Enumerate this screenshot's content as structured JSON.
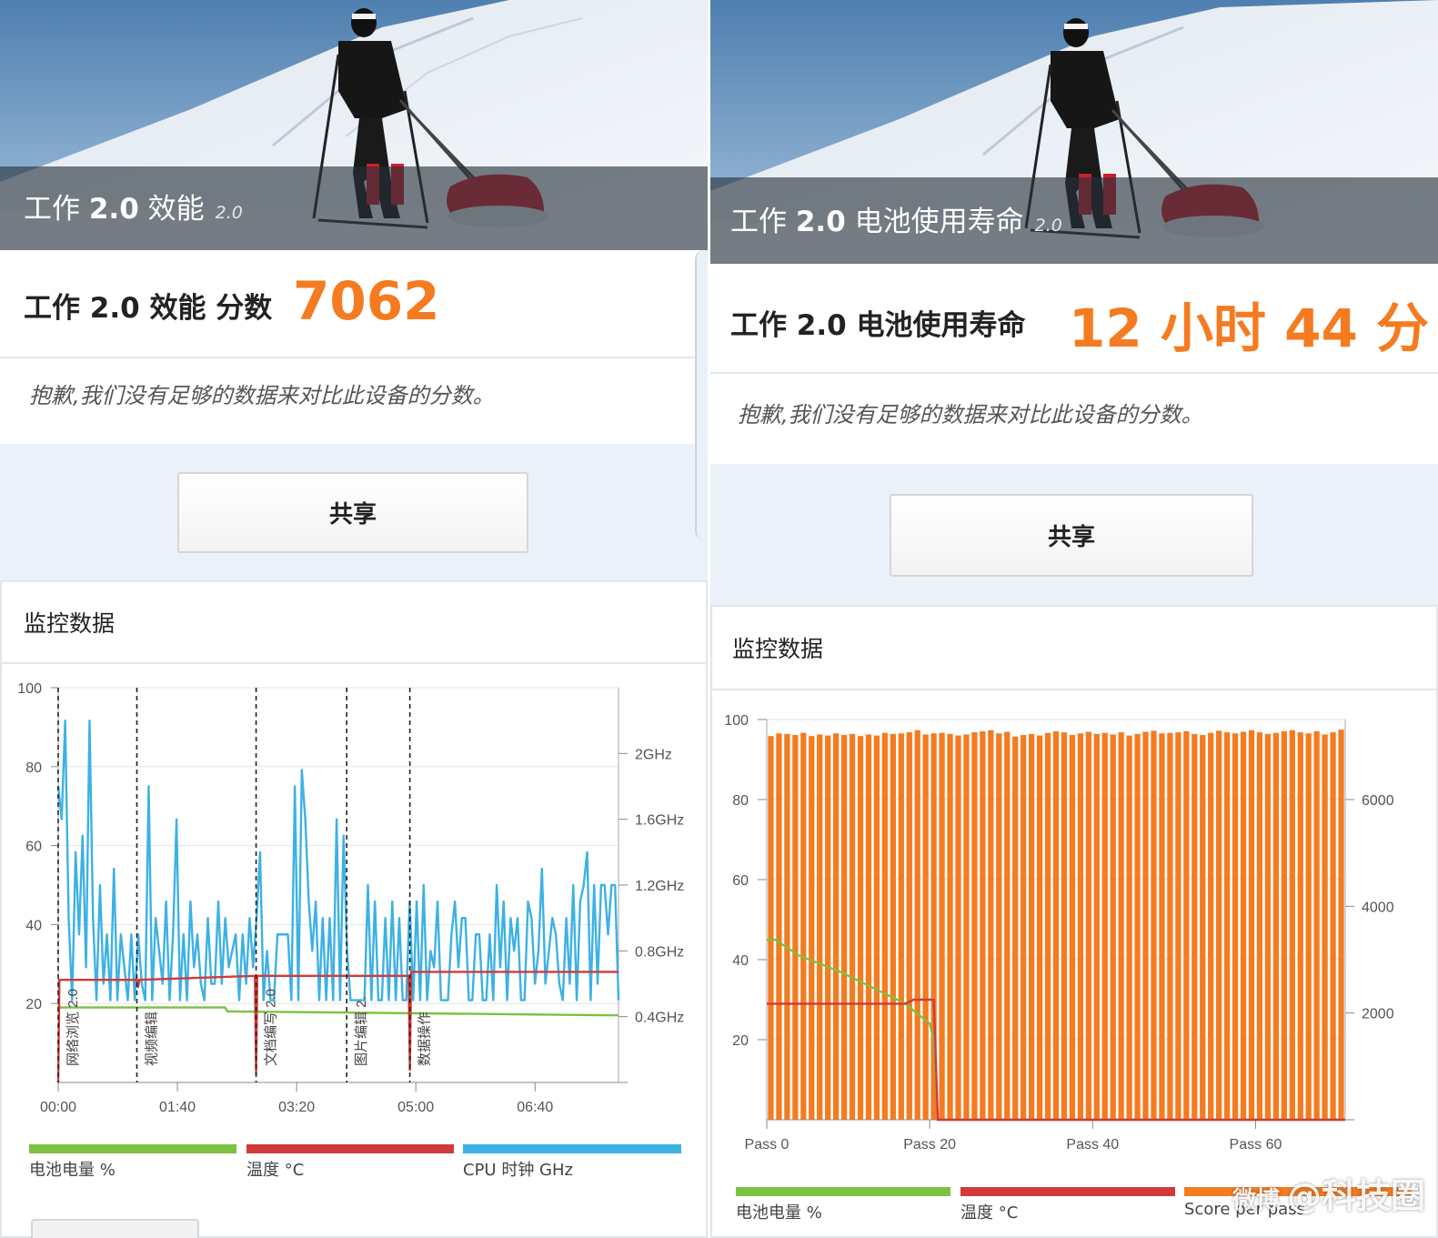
{
  "left": {
    "hero": {
      "title_part1": "工作 ",
      "title_bold": "2.0",
      "title_part2": " 效能",
      "version": "2.0"
    },
    "score": {
      "label": "工作 2.0 效能 分数",
      "value": "7062"
    },
    "sorry": "抱歉,我们没有足够的数据来对比此设备的分数。",
    "share_label": "共享",
    "monitor_title": "监控数据",
    "legend": [
      {
        "label": "电池电量 %",
        "color": "#7cc142"
      },
      {
        "label": "温度 °C",
        "color": "#d23a3a"
      },
      {
        "label": "CPU 时钟 GHz",
        "color": "#3db1e3"
      }
    ]
  },
  "right": {
    "hero": {
      "title_part1": "工作 ",
      "title_bold": "2.0",
      "title_part2": " 电池使用寿命",
      "version": "2.0"
    },
    "score": {
      "label": "工作 2.0 电池使用寿命",
      "value": "12 小时 44 分"
    },
    "sorry": "抱歉,我们没有足够的数据来对比此设备的分数。",
    "share_label": "共享",
    "monitor_title": "监控数据",
    "legend": [
      {
        "label": "电池电量 %",
        "color": "#7cc142"
      },
      {
        "label": "温度 °C",
        "color": "#d23a3a"
      },
      {
        "label": "Score per pass",
        "color": "#f47b20"
      }
    ]
  },
  "watermark": {
    "brand": "微博",
    "text": "@科技圈"
  },
  "chart_data": [
    {
      "type": "line",
      "x_ticks": [
        "00:00",
        "01:40",
        "03:20",
        "05:00",
        "06:40"
      ],
      "y_left_ticks": [
        "100",
        "80",
        "60",
        "40",
        "20"
      ],
      "y_left_range": [
        0,
        100
      ],
      "y_right_ticks": [
        "2GHz",
        "1.6GHz",
        "1.2GHz",
        "0.8GHz",
        "0.4GHz"
      ],
      "y_right_values": [
        2.0,
        1.6,
        1.2,
        0.8,
        0.4
      ],
      "y_right_range": [
        0,
        2.4
      ],
      "x_range_seconds": [
        0,
        470
      ],
      "phases": [
        {
          "label": "网络浏览 2.0",
          "t": 0
        },
        {
          "label": "视频编辑",
          "t": 66
        },
        {
          "label": "文档编写 2.0",
          "t": 166
        },
        {
          "label": "图片编辑 2.",
          "t": 242
        },
        {
          "label": "数据操作",
          "t": 295
        }
      ],
      "series": [
        {
          "name": "电池电量 %",
          "color": "#7cc142",
          "points": [
            [
              0,
              19
            ],
            [
              140,
              19
            ],
            [
              142,
              18
            ],
            [
              470,
              17
            ]
          ]
        },
        {
          "name": "温度 °C",
          "color": "#d23a3a",
          "points": [
            [
              0,
              0
            ],
            [
              1,
              26
            ],
            [
              66,
              26
            ],
            [
              67,
              24
            ],
            [
              68,
              26
            ],
            [
              165,
              27
            ],
            [
              166,
              2
            ],
            [
              167,
              27
            ],
            [
              242,
              27
            ],
            [
              243,
              27
            ],
            [
              294,
              27
            ],
            [
              295,
              3
            ],
            [
              296,
              28
            ],
            [
              470,
              28
            ]
          ]
        },
        {
          "name": "CPU 时钟 GHz",
          "color": "#3db1e3",
          "values_ghz": [
            1.8,
            1.6,
            2.2,
            1.0,
            0.5,
            1.4,
            0.9,
            1.5,
            0.7,
            2.2,
            1.0,
            0.5,
            1.2,
            0.6,
            0.9,
            0.5,
            1.3,
            0.5,
            0.9,
            0.7,
            0.5,
            0.9,
            0.5,
            0.9,
            0.6,
            0.5,
            1.8,
            0.5,
            1.0,
            0.8,
            0.6,
            1.1,
            0.5,
            0.9,
            1.6,
            0.5,
            0.9,
            0.5,
            1.1,
            0.7,
            0.9,
            0.6,
            0.5,
            1.0,
            0.6,
            0.6,
            1.1,
            0.6,
            1.0,
            0.7,
            0.8,
            0.9,
            0.5,
            0.9,
            0.6,
            1.0,
            0.7,
            1.0,
            1.4,
            0.5,
            0.8,
            0.5,
            0.5,
            0.9,
            0.9,
            0.9,
            0.9,
            0.5,
            1.8,
            0.5,
            1.9,
            1.6,
            1.1,
            0.8,
            1.1,
            0.5,
            1.0,
            0.5,
            1.0,
            0.5,
            1.6,
            0.5,
            1.5,
            0.8,
            0.5,
            0.5,
            0.5,
            0.5,
            0.5,
            1.2,
            0.5,
            1.1,
            0.5,
            0.5,
            1.0,
            0.5,
            1.1,
            0.5,
            1.0,
            0.5,
            0.5,
            1.1,
            0.5,
            1.1,
            0.5,
            1.2,
            0.5,
            0.8,
            0.7,
            1.1,
            0.5,
            0.5,
            0.5,
            0.9,
            1.1,
            0.7,
            1.0,
            1.0,
            0.5,
            0.5,
            0.9,
            0.9,
            0.5,
            0.5,
            0.9,
            0.5,
            1.2,
            0.7,
            1.1,
            0.5,
            1.0,
            0.8,
            1.0,
            0.5,
            0.5,
            1.1,
            1.0,
            0.6,
            0.8,
            1.3,
            0.6,
            0.8,
            1.0,
            0.9,
            0.6,
            0.5,
            1.0,
            0.6,
            1.2,
            0.5,
            1.1,
            1.2,
            1.4,
            0.5,
            1.2,
            0.6,
            1.2,
            1.2,
            0.9,
            1.2,
            1.2,
            0.5
          ]
        }
      ]
    },
    {
      "type": "bar",
      "x_ticks": [
        "Pass 0",
        "Pass 20",
        "Pass 40",
        "Pass 60"
      ],
      "y_left_ticks": [
        "100",
        "80",
        "60",
        "40",
        "20"
      ],
      "y_left_range": [
        0,
        100
      ],
      "y_right_ticks": [
        "6000",
        "4000",
        "2000"
      ],
      "y_right_range": [
        0,
        7500
      ],
      "pass_count": 71,
      "series": [
        {
          "name": "Score per pass",
          "color": "#f47b20",
          "values": [
            7190,
            7240,
            7230,
            7210,
            7250,
            7190,
            7220,
            7200,
            7240,
            7210,
            7230,
            7190,
            7220,
            7200,
            7250,
            7230,
            7240,
            7260,
            7300,
            7220,
            7240,
            7250,
            7230,
            7200,
            7220,
            7260,
            7280,
            7300,
            7240,
            7270,
            7180,
            7210,
            7230,
            7200,
            7250,
            7280,
            7260,
            7210,
            7240,
            7270,
            7230,
            7250,
            7220,
            7260,
            7200,
            7230,
            7270,
            7290,
            7240,
            7250,
            7260,
            7280,
            7230,
            7210,
            7250,
            7290,
            7260,
            7240,
            7270,
            7300,
            7260,
            7230,
            7250,
            7280,
            7300,
            7260,
            7240,
            7280,
            7220,
            7260,
            7310
          ]
        },
        {
          "name": "电池电量 %",
          "color": "#7cc142",
          "points": [
            [
              0,
              45
            ],
            [
              1,
              45
            ],
            [
              4,
              41
            ],
            [
              9,
              37
            ],
            [
              13,
              33
            ],
            [
              17,
              29
            ],
            [
              20,
              24
            ],
            [
              20.5,
              20
            ],
            [
              21,
              0
            ],
            [
              71,
              0
            ]
          ]
        },
        {
          "name": "温度 °C",
          "color": "#d23a3a",
          "points": [
            [
              0,
              29
            ],
            [
              17,
              29
            ],
            [
              18,
              30
            ],
            [
              20.5,
              30
            ],
            [
              21,
              0
            ],
            [
              71,
              0
            ]
          ]
        }
      ]
    }
  ]
}
